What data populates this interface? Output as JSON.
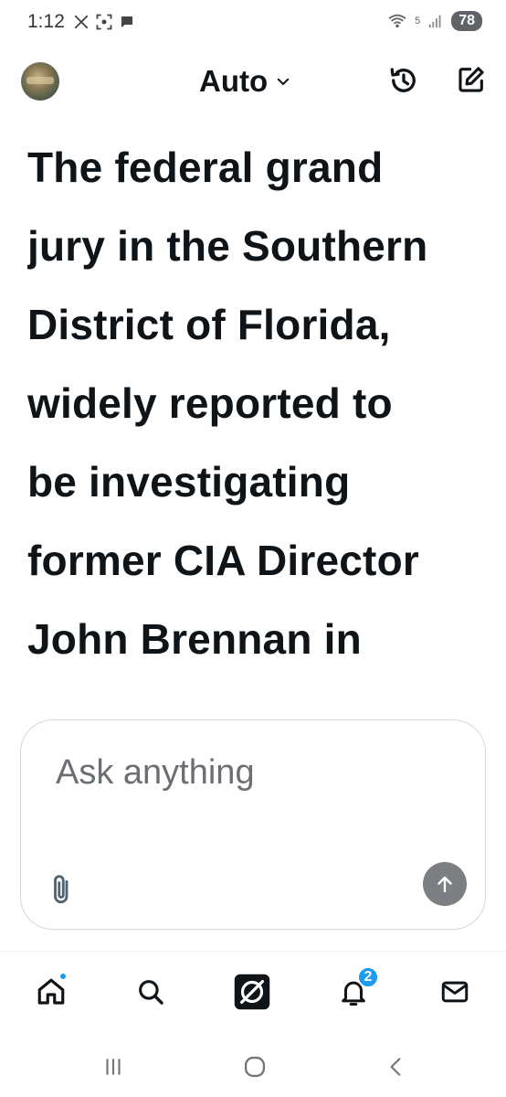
{
  "status_bar": {
    "time": "1:12",
    "battery": "78",
    "wifi_label": "5",
    "icons_left": [
      "x-logo-icon",
      "screenshot-icon",
      "chat-bubble-icon"
    ]
  },
  "header": {
    "mode_label": "Auto",
    "mode_chevron": "chevron-down-icon",
    "history_icon": "history-icon",
    "compose_icon": "compose-icon"
  },
  "response": {
    "lines": [
      "The federal grand",
      "jury in the Southern",
      "District of Florida,",
      "widely reported to",
      "be investigating",
      "former CIA Director",
      "John Brennan in"
    ]
  },
  "composer": {
    "placeholder": "Ask anything",
    "value": ""
  },
  "tab_bar": {
    "notification_count": "2",
    "tabs": [
      "home-icon",
      "search-icon",
      "grok-icon",
      "notifications-icon",
      "messages-icon"
    ]
  },
  "colors": {
    "accent": "#1d9bf0",
    "text": "#0f1419",
    "send_button": "#7b7f83"
  }
}
